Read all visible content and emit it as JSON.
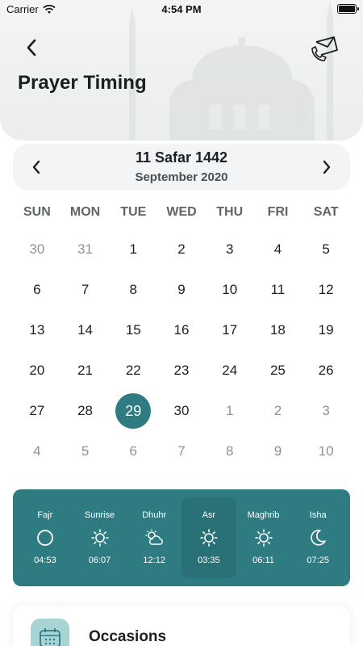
{
  "status_bar": {
    "carrier": "Carrier",
    "time": "4:54 PM"
  },
  "header": {
    "title": "Prayer Timing",
    "back_icon": "chevron-left-icon",
    "action_icon": "mail-phone-icon"
  },
  "date": {
    "hijri": "11 Safar 1442",
    "gregorian": "September 2020"
  },
  "calendar": {
    "weekdays": [
      "SUN",
      "MON",
      "TUE",
      "WED",
      "THU",
      "FRI",
      "SAT"
    ],
    "days": [
      {
        "n": "30",
        "muted": true
      },
      {
        "n": "31",
        "muted": true
      },
      {
        "n": "1"
      },
      {
        "n": "2"
      },
      {
        "n": "3"
      },
      {
        "n": "4"
      },
      {
        "n": "5"
      },
      {
        "n": "6"
      },
      {
        "n": "7"
      },
      {
        "n": "8"
      },
      {
        "n": "9"
      },
      {
        "n": "10"
      },
      {
        "n": "11"
      },
      {
        "n": "12"
      },
      {
        "n": "13"
      },
      {
        "n": "14"
      },
      {
        "n": "15"
      },
      {
        "n": "16"
      },
      {
        "n": "17"
      },
      {
        "n": "18"
      },
      {
        "n": "19"
      },
      {
        "n": "20"
      },
      {
        "n": "21"
      },
      {
        "n": "22"
      },
      {
        "n": "23"
      },
      {
        "n": "24"
      },
      {
        "n": "25"
      },
      {
        "n": "26"
      },
      {
        "n": "27"
      },
      {
        "n": "28"
      },
      {
        "n": "29",
        "selected": true
      },
      {
        "n": "30"
      },
      {
        "n": "1",
        "muted": true
      },
      {
        "n": "2",
        "muted": true
      },
      {
        "n": "3",
        "muted": true
      },
      {
        "n": "4",
        "muted": true
      },
      {
        "n": "5",
        "muted": true
      },
      {
        "n": "6",
        "muted": true
      },
      {
        "n": "7",
        "muted": true
      },
      {
        "n": "8",
        "muted": true
      },
      {
        "n": "9",
        "muted": true
      },
      {
        "n": "10",
        "muted": true
      }
    ]
  },
  "prayers": [
    {
      "name": "Fajr",
      "time": "04:53",
      "icon": "circle-icon"
    },
    {
      "name": "Sunrise",
      "time": "06:07",
      "icon": "sun-icon"
    },
    {
      "name": "Dhuhr",
      "time": "12:12",
      "icon": "sun-cloud-icon"
    },
    {
      "name": "Asr",
      "time": "03:35",
      "icon": "sun-icon",
      "active": true
    },
    {
      "name": "Maghrib",
      "time": "06:11",
      "icon": "sun-icon"
    },
    {
      "name": "Isha",
      "time": "07:25",
      "icon": "moon-icon"
    }
  ],
  "occasions": {
    "label": "Occasions",
    "icon": "calendar-grid-icon"
  },
  "colors": {
    "accent": "#2e7b82",
    "occasions_icon_bg": "#a9d4d6",
    "date_bar_bg": "#f2f4f6"
  }
}
